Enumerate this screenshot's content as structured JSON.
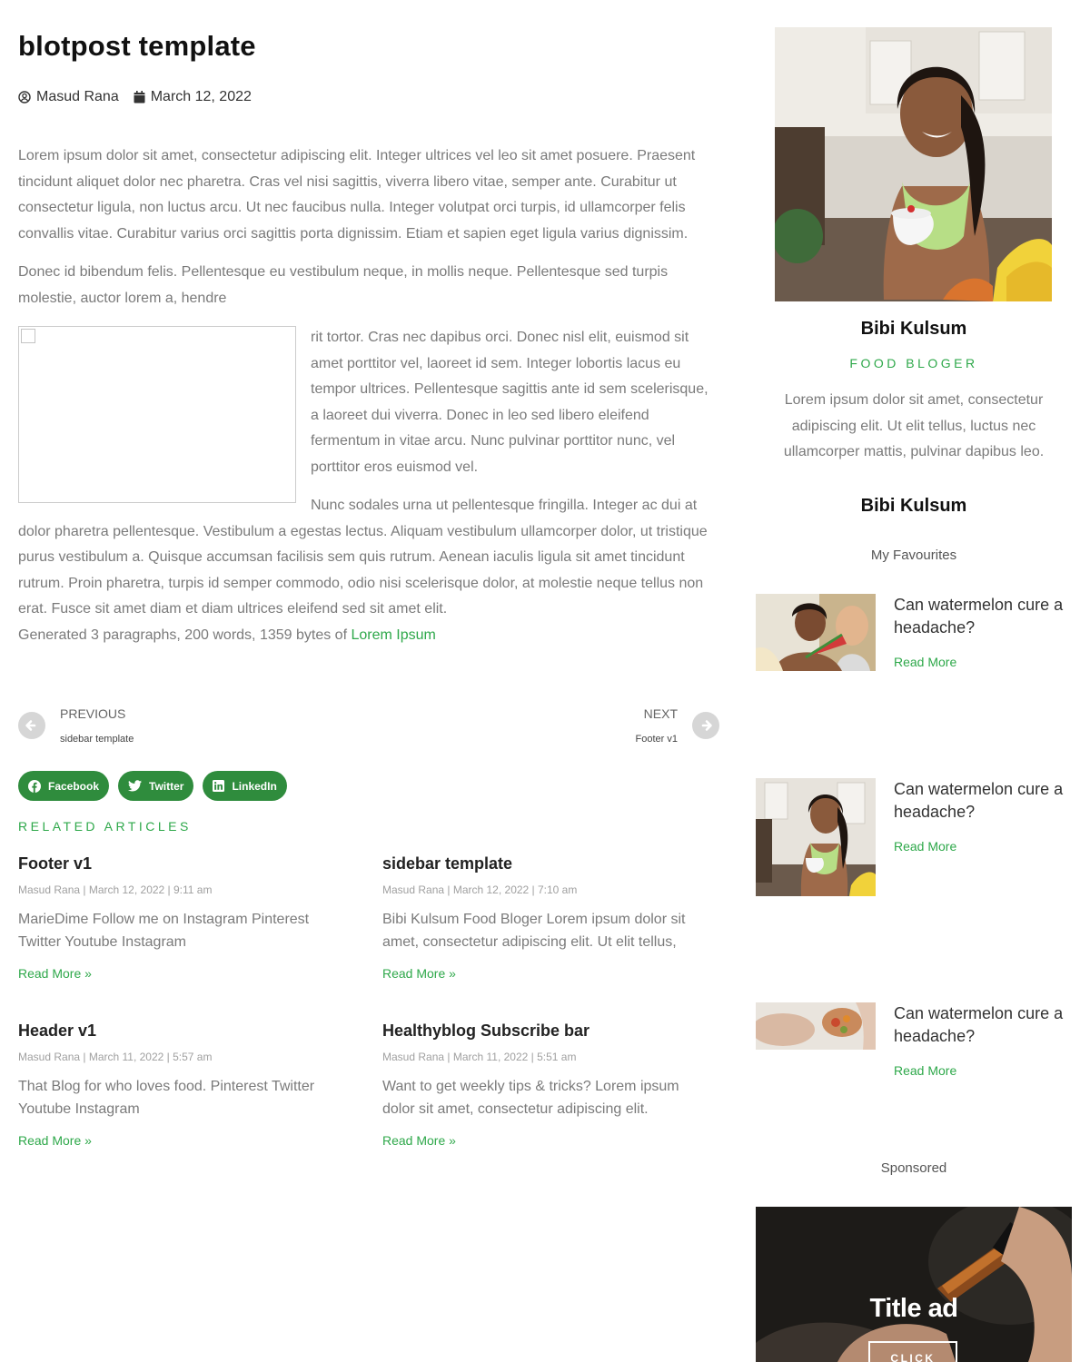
{
  "post": {
    "title": "blotpost template",
    "author": "Masud Rana",
    "date": "March 12, 2022",
    "paragraph_1": "Lorem ipsum dolor sit amet, consectetur adipiscing elit. Integer ultrices vel leo sit amet posuere. Praesent tincidunt aliquet dolor nec pharetra. Cras vel nisi sagittis, viverra libero vitae, semper ante. Curabitur ut consectetur ligula, non luctus arcu. Ut nec faucibus nulla. Integer volutpat orci turpis, id ullamcorper felis convallis vitae. Curabitur varius orci sagittis porta dignissim. Etiam et sapien eget ligula varius dignissim.",
    "paragraph_2": "Donec id bibendum felis. Pellentesque eu vestibulum neque, in mollis neque. Pellentesque sed turpis molestie, auctor lorem a, hendre",
    "paragraph_3a": "rit tortor. Cras nec dapibus orci. Donec nisl elit, euismod sit amet porttitor vel, laoreet id sem. Integer lobortis lacus eu tempor ultrices. Pellentesque sagittis ante id sem scelerisque, a laoreet dui viverra. Donec in leo sed libero eleifend fermentum in vitae arcu. Nunc pulvinar porttitor nunc, vel porttitor eros euismod vel.",
    "paragraph_3b": "Nunc sodales urna ut pellentesque fringilla. Integer ac dui at dolor pharetra pellentesque. Vestibulum a egestas lectus. Aliquam vestibulum ullamcorper dolor, ut tristique purus vestibulum a. Quisque accumsan facilisis sem quis rutrum. Aenean iaculis ligula sit amet tincidunt rutrum. Proin pharetra, turpis id semper commodo, odio nisi scelerisque dolor, at molestie neque tellus non erat. Fusce sit amet diam et diam ultrices eleifend sed sit amet elit.",
    "generated_text": "Generated 3 paragraphs, 200 words, 1359 bytes of",
    "generated_link": "Lorem Ipsum"
  },
  "post_nav": {
    "prev_label": "PREVIOUS",
    "prev_title": "sidebar template",
    "next_label": "NEXT",
    "next_title": "Footer v1"
  },
  "share": {
    "facebook": "Facebook",
    "twitter": "Twitter",
    "linkedin": "LinkedIn"
  },
  "related": {
    "heading": "RELATED ARTICLES",
    "items": [
      {
        "title": "Footer v1",
        "meta": "Masud Rana | March 12, 2022 | 9:11 am",
        "excerpt": "MarieDime Follow me on Instagram Pinterest Twitter Youtube Instagram",
        "more": "Read More »"
      },
      {
        "title": "sidebar template",
        "meta": "Masud Rana | March 12, 2022 | 7:10 am",
        "excerpt": "Bibi Kulsum Food Bloger Lorem ipsum dolor sit amet, consectetur adipiscing elit. Ut elit tellus,",
        "more": "Read More »"
      },
      {
        "title": "Header v1",
        "meta": "Masud Rana | March 11, 2022 | 5:57 am",
        "excerpt": "That Blog for who loves food. Pinterest Twitter Youtube Instagram",
        "more": "Read More »"
      },
      {
        "title": "Healthyblog Subscribe bar",
        "meta": "Masud Rana | March 11, 2022 | 5:51 am",
        "excerpt": "Want to get weekly tips & tricks? Lorem ipsum dolor sit amet, consectetur adipiscing elit.",
        "more": "Read More »"
      }
    ]
  },
  "sidebar": {
    "author_name": "Bibi Kulsum",
    "author_role": "FOOD BLOGER",
    "author_bio": "Lorem ipsum dolor sit amet, consectetur adipiscing elit. Ut elit tellus, luctus nec ullamcorper mattis, pulvinar dapibus leo.",
    "author_name_2": "Bibi Kulsum",
    "favourites_heading": "My Favourites",
    "favourites": [
      {
        "title": "Can watermelon cure a headache?",
        "more": "Read More"
      },
      {
        "title": "Can watermelon cure a headache?",
        "more": "Read More"
      },
      {
        "title": "Can watermelon cure a headache?",
        "more": "Read More"
      }
    ],
    "sponsored": "Sponsored",
    "ad_title": "Title ad",
    "ad_button": "CLICK"
  },
  "colors": {
    "accent_green": "#2ea84a",
    "share_button": "#2f8c3d",
    "body_text": "#7a7a7a"
  }
}
